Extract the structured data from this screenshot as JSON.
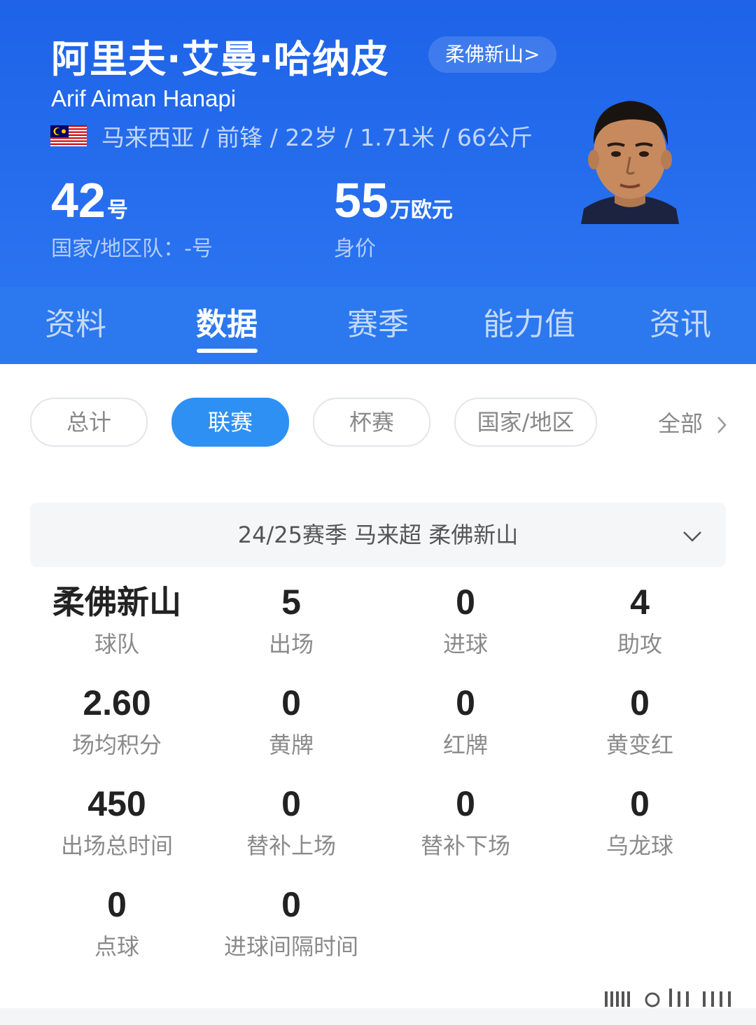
{
  "player": {
    "name_cn": "阿里夫·艾曼·哈纳皮",
    "club_link": "柔佛新山>",
    "name_en": "Arif Aiman Hanapi",
    "meta": "马来西亚 / 前锋 / 22岁 / 1.71米 / 66公斤",
    "number": "42",
    "number_unit": "号",
    "national_team": "国家/地区队：-号",
    "value": "55",
    "value_unit": "万欧元",
    "value_label": "身价"
  },
  "tabs": [
    "资料",
    "数据",
    "赛季",
    "能力值",
    "资讯"
  ],
  "filters": {
    "chips": [
      "总计",
      "联赛",
      "杯赛",
      "国家/地区"
    ],
    "all": "全部"
  },
  "season_selector": "24/25赛季 马来超 柔佛新山",
  "stats": [
    {
      "value": "柔佛新山",
      "label": "球队"
    },
    {
      "value": "5",
      "label": "出场"
    },
    {
      "value": "0",
      "label": "进球"
    },
    {
      "value": "4",
      "label": "助攻"
    },
    {
      "value": "2.60",
      "label": "场均积分"
    },
    {
      "value": "0",
      "label": "黄牌"
    },
    {
      "value": "0",
      "label": "红牌"
    },
    {
      "value": "0",
      "label": "黄变红"
    },
    {
      "value": "450",
      "label": "出场总时间"
    },
    {
      "value": "0",
      "label": "替补上场"
    },
    {
      "value": "0",
      "label": "替补下场"
    },
    {
      "value": "0",
      "label": "乌龙球"
    },
    {
      "value": "0",
      "label": "点球"
    },
    {
      "value": "0",
      "label": "进球间隔时间"
    }
  ],
  "colors": {
    "header_blue": "#1e63e8",
    "tab_blue": "#2c78ee",
    "chip_active": "#2e90f2"
  }
}
